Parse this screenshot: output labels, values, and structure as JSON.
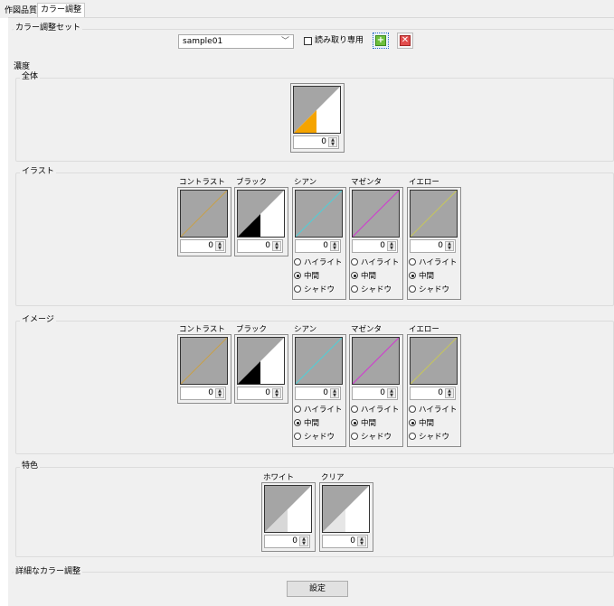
{
  "tabs": [
    {
      "label": "作図品質",
      "active": false
    },
    {
      "label": "カラー調整",
      "active": true
    }
  ],
  "preset": {
    "group_label": "カラー調整セット",
    "selected": "sample01",
    "readonly_label": "読み取り専用",
    "readonly_checked": false
  },
  "density": {
    "group_label": "濃度",
    "overall": {
      "label": "全体",
      "value": "0"
    },
    "illust": {
      "label": "イラスト",
      "channels": [
        {
          "title": "コントラスト",
          "value": "0"
        },
        {
          "title": "ブラック",
          "value": "0"
        },
        {
          "title": "シアン",
          "value": "0",
          "line_color": "#4fd0d8",
          "mode": "中間"
        },
        {
          "title": "マゼンタ",
          "value": "0",
          "line_color": "#d236d2",
          "mode": "中間"
        },
        {
          "title": "イエロー",
          "value": "0",
          "line_color": "#c6c65a",
          "mode": "中間"
        }
      ]
    },
    "image": {
      "label": "イメージ",
      "channels": [
        {
          "title": "コントラスト",
          "value": "0"
        },
        {
          "title": "ブラック",
          "value": "0"
        },
        {
          "title": "シアン",
          "value": "0",
          "line_color": "#4fd0d8",
          "mode": "中間"
        },
        {
          "title": "マゼンタ",
          "value": "0",
          "line_color": "#d236d2",
          "mode": "中間"
        },
        {
          "title": "イエロー",
          "value": "0",
          "line_color": "#c6c65a",
          "mode": "中間"
        }
      ]
    },
    "tone_options": [
      "ハイライト",
      "中間",
      "シャドウ"
    ],
    "special": {
      "label": "特色",
      "channels": [
        {
          "title": "ホワイト",
          "value": "0"
        },
        {
          "title": "クリア",
          "value": "0"
        }
      ]
    }
  },
  "detail": {
    "group_label": "詳細なカラー調整",
    "button_label": "設定"
  },
  "colors": {
    "panel_bg": "#f0f0f0",
    "curve_gray": "#a5a5a5",
    "overall_orange": "#f5a400",
    "contrast_line": "#c8a048"
  },
  "icons": [
    "add-icon",
    "delete-icon",
    "chevron-down-icon",
    "spin-up-icon",
    "spin-down-icon"
  ]
}
